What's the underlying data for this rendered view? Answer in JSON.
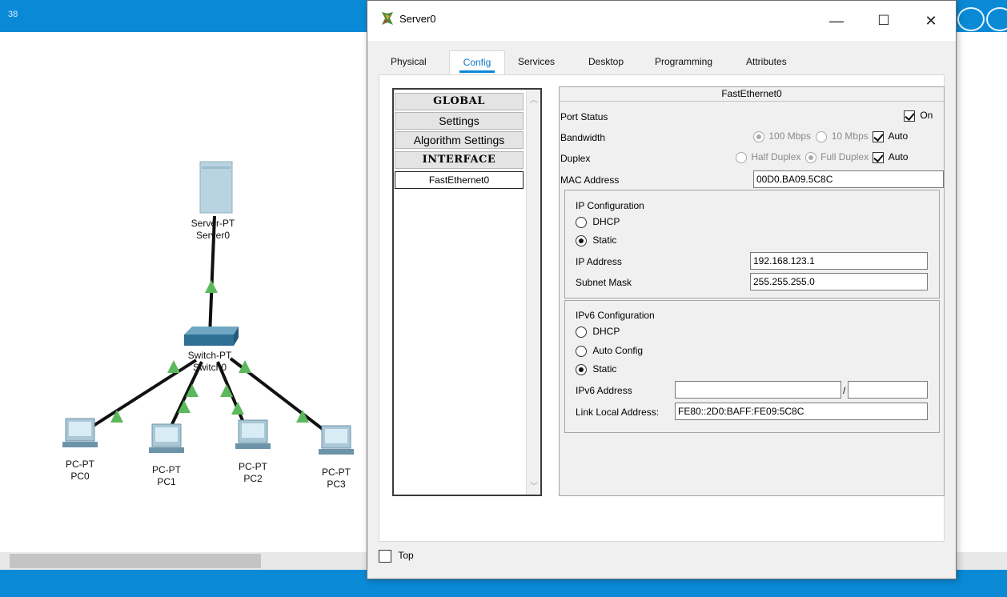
{
  "background": {
    "app_title": "38",
    "devices": {
      "server": {
        "type": "Server-PT",
        "name": "Server0"
      },
      "switch": {
        "type": "Switch-PT",
        "name": "Switch0"
      },
      "pcs": [
        {
          "type": "PC-PT",
          "name": "PC0"
        },
        {
          "type": "PC-PT",
          "name": "PC1"
        },
        {
          "type": "PC-PT",
          "name": "PC2"
        },
        {
          "type": "PC-PT",
          "name": "PC3"
        }
      ]
    }
  },
  "window": {
    "title": "Server0",
    "minimize": "—",
    "maximize": "☐",
    "close": "✕"
  },
  "tabs": [
    {
      "label": "Physical"
    },
    {
      "label": "Config"
    },
    {
      "label": "Services"
    },
    {
      "label": "Desktop"
    },
    {
      "label": "Programming"
    },
    {
      "label": "Attributes"
    }
  ],
  "sidebar": {
    "global": "GLOBAL",
    "settings": "Settings",
    "algorithm_settings": "Algorithm Settings",
    "interface": "INTERFACE",
    "fastethernet": "FastEthernet0"
  },
  "panel": {
    "header": "FastEthernet0",
    "port_status": {
      "label": "Port Status",
      "on_label": "On",
      "on_checked": true
    },
    "bandwidth": {
      "label": "Bandwidth",
      "opt1": "100 Mbps",
      "opt2": "10 Mbps",
      "auto": "Auto"
    },
    "duplex": {
      "label": "Duplex",
      "opt1": "Half Duplex",
      "opt2": "Full Duplex",
      "auto": "Auto"
    },
    "mac": {
      "label": "MAC Address",
      "value": "00D0.BA09.5C8C"
    },
    "ipv4": {
      "title": "IP Configuration",
      "dhcp": "DHCP",
      "static": "Static",
      "ip_label": "IP Address",
      "ip_value": "192.168.123.1",
      "mask_label": "Subnet Mask",
      "mask_value": "255.255.255.0"
    },
    "ipv6": {
      "title": "IPv6 Configuration",
      "dhcp": "DHCP",
      "auto": "Auto Config",
      "static": "Static",
      "addr_label": "IPv6 Address",
      "addr_value": "",
      "prefix_sep": "/",
      "prefix_value": "",
      "ll_label": "Link Local Address:",
      "ll_value": "FE80::2D0:BAFF:FE09:5C8C"
    }
  },
  "footer": {
    "top_label": "Top"
  }
}
